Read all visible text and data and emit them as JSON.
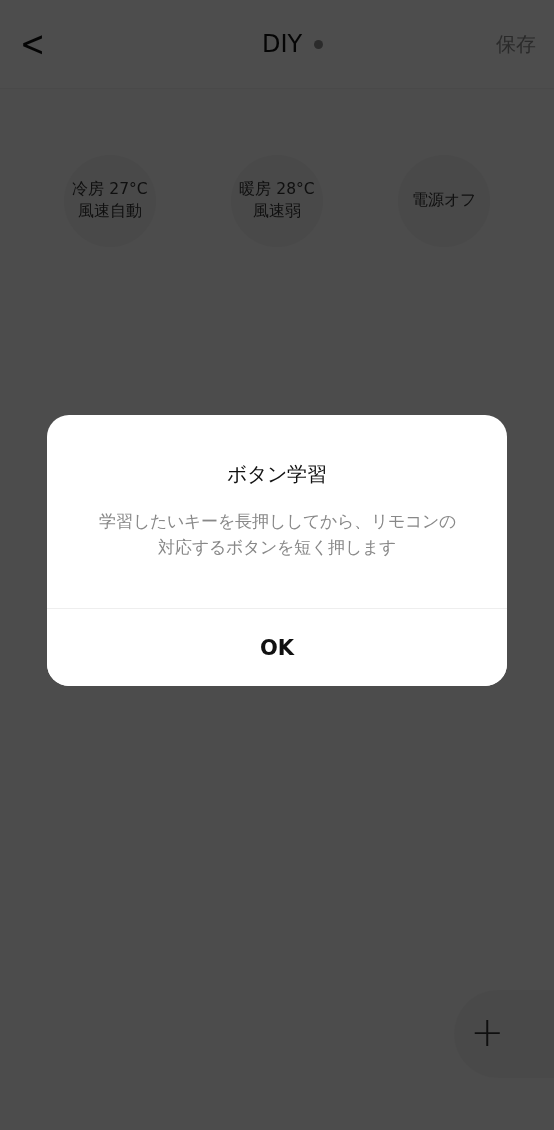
{
  "header": {
    "back": "<",
    "title": "DIY",
    "save": "保存"
  },
  "buttons": [
    {
      "label": "冷房 27°C\n風速自動"
    },
    {
      "label": "暖房 28°C\n風速弱"
    },
    {
      "label": "電源オフ"
    }
  ],
  "fab": {
    "label": "+"
  },
  "dialog": {
    "title": "ボタン学習",
    "message": "学習したいキーを長押ししてから、リモコンの対応するボタンを短く押します",
    "ok": "OK"
  }
}
